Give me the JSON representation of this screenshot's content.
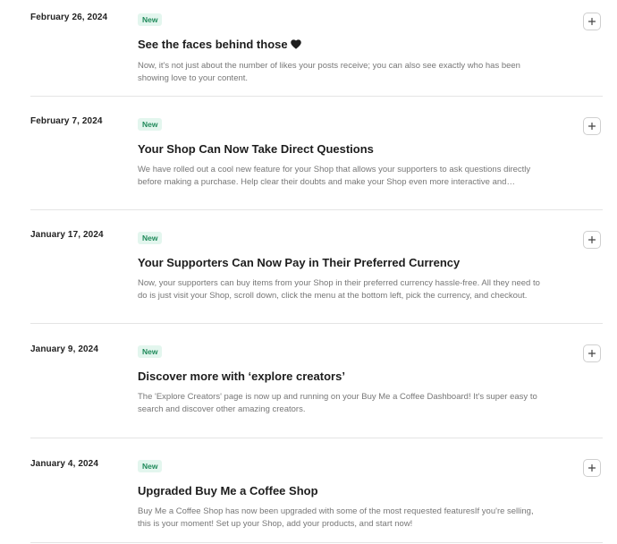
{
  "changelog": {
    "entries": [
      {
        "date": "February 26, 2024",
        "badge": "New",
        "title": "See the faces behind those",
        "title_icon": "heart-icon",
        "description": "Now, it's not just about the number of likes your posts receive; you can also see exactly who has been showing love to your content."
      },
      {
        "date": "February 7, 2024",
        "badge": "New",
        "title": "Your Shop Can Now Take Direct Questions",
        "description": "We have rolled out a cool new feature for your Shop that allows your supporters to ask questions directly before making a purchase. Help clear their doubts and make your Shop even more interactive and engaging."
      },
      {
        "date": "January 17, 2024",
        "badge": "New",
        "title": "Your Supporters Can Now Pay in Their Preferred Currency",
        "description": "Now, your supporters can buy items from your Shop in their preferred currency hassle-free. All they need to do is just visit your Shop, scroll down, click the menu at the bottom left, pick the currency, and checkout."
      },
      {
        "date": "January 9, 2024",
        "badge": "New",
        "title": "Discover more with ‘explore creators’",
        "description": "The 'Explore Creators' page is now up and running on your Buy Me a Coffee Dashboard! It's super easy to search and discover other amazing creators."
      },
      {
        "date": "January 4, 2024",
        "badge": "New",
        "title": "Upgraded Buy Me a Coffee Shop",
        "description": "Buy Me a Coffee Shop has now been upgraded with some of the most requested featuresIf you're selling, this is your moment! Set up your Shop, add your products, and start now!"
      }
    ],
    "expand_icon": "plus-icon",
    "colors": {
      "badge_bg": "#e3f6ee",
      "badge_text": "#1f8a5a",
      "divider": "#e4e4e4",
      "title": "#1d1d1d",
      "description": "#777777"
    }
  }
}
